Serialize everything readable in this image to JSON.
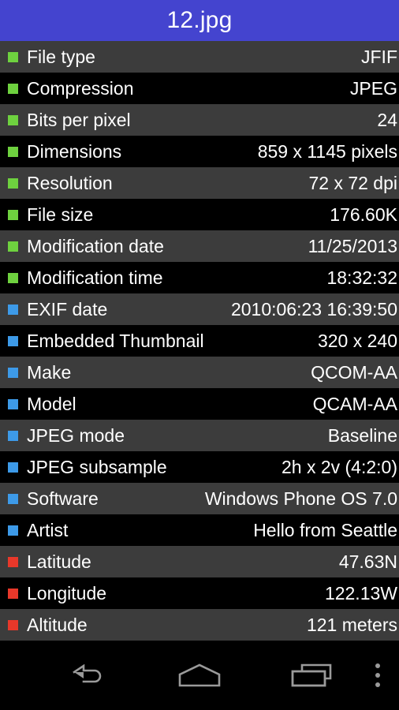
{
  "window": {
    "title": "12.jpg"
  },
  "theme": {
    "titlebar_bg": "#4444cf",
    "row_odd_bg": "#3c3c3c",
    "row_even_bg": "#000000",
    "text_color": "#ffffff",
    "bullet_green": "#6ed13f",
    "bullet_blue": "#3d9ae8",
    "bullet_red": "#e8382a",
    "navbar_bg": "#000000",
    "nav_icon_color": "#9a9a9a"
  },
  "properties": [
    {
      "bullet": "green",
      "label": "File type",
      "value": "JFIF"
    },
    {
      "bullet": "green",
      "label": "Compression",
      "value": "JPEG"
    },
    {
      "bullet": "green",
      "label": "Bits per pixel",
      "value": "24"
    },
    {
      "bullet": "green",
      "label": "Dimensions",
      "value": "859 x 1145 pixels"
    },
    {
      "bullet": "green",
      "label": "Resolution",
      "value": "72 x 72 dpi"
    },
    {
      "bullet": "green",
      "label": "File size",
      "value": "176.60K"
    },
    {
      "bullet": "green",
      "label": "Modification date",
      "value": "11/25/2013"
    },
    {
      "bullet": "green",
      "label": "Modification time",
      "value": "18:32:32"
    },
    {
      "bullet": "blue",
      "label": "EXIF date",
      "value": "2010:06:23 16:39:50"
    },
    {
      "bullet": "blue",
      "label": "Embedded Thumbnail",
      "value": "320 x 240"
    },
    {
      "bullet": "blue",
      "label": "Make",
      "value": "QCOM-AA"
    },
    {
      "bullet": "blue",
      "label": "Model",
      "value": "QCAM-AA"
    },
    {
      "bullet": "blue",
      "label": "JPEG mode",
      "value": "Baseline"
    },
    {
      "bullet": "blue",
      "label": "JPEG subsample",
      "value": "2h x 2v (4:2:0)"
    },
    {
      "bullet": "blue",
      "label": "Software",
      "value": "Windows Phone OS 7.0"
    },
    {
      "bullet": "blue",
      "label": "Artist",
      "value": "Hello from Seattle"
    },
    {
      "bullet": "red",
      "label": "Latitude",
      "value": "47.63N"
    },
    {
      "bullet": "red",
      "label": "Longitude",
      "value": "122.13W"
    },
    {
      "bullet": "red",
      "label": "Altitude",
      "value": "121 meters"
    }
  ],
  "navbar": {
    "buttons": [
      {
        "icon": "back-icon",
        "label": "Back"
      },
      {
        "icon": "home-icon",
        "label": "Home"
      },
      {
        "icon": "recents-icon",
        "label": "Recent apps"
      },
      {
        "icon": "overflow-icon",
        "label": "More options"
      }
    ]
  }
}
